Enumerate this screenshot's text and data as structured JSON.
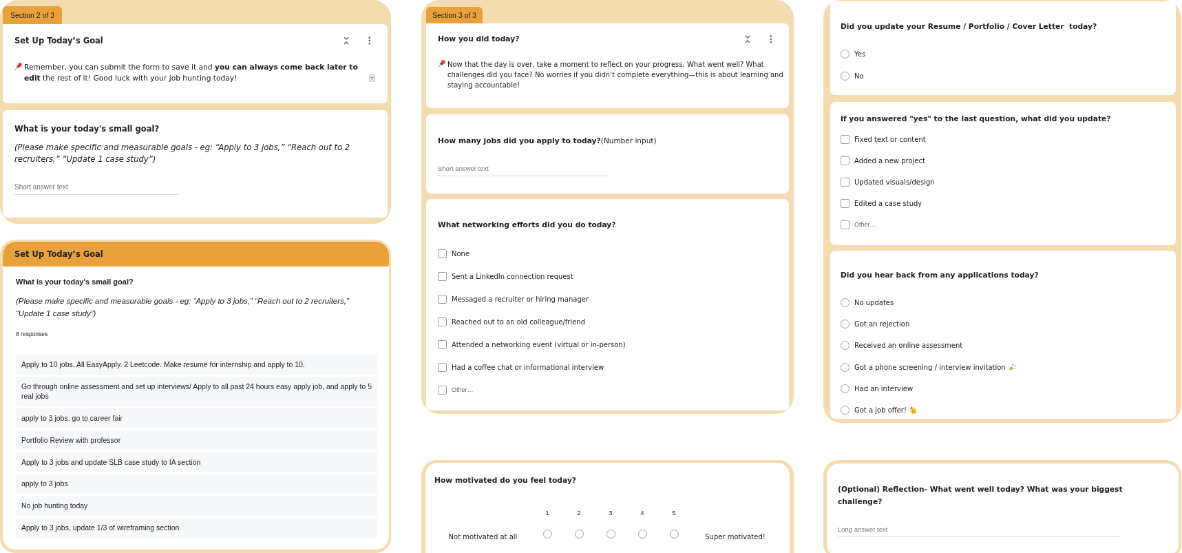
{
  "section_2": {
    "section_label": "Section 2 of 3",
    "header": {
      "title": "Set Up Today’s Goal",
      "description": "Remember, you can submit the form to save it and **you can always come back later to edit** the rest of it! Good luck with your job hunting today!",
      "closing_icon": true
    },
    "questions": [
      {
        "kind": "short_answer",
        "title": "What is your today's small goal?",
        "description": "(Please make specific and measurable goals - eg: “Apply to 3 jobs,” “Reach out to 2 recruiters,” “Update 1 case study”)",
        "placeholder": "Short answer text"
      }
    ]
  },
  "responses_summary": {
    "header": "Set Up Today’s Goal",
    "question": "What is your today's small goal?",
    "description": "(Please make specific and measurable goals - eg: “Apply to 3 jobs,” “Reach out to 2 recruiters,” “Update 1 case study”)",
    "response_count": "8 responses",
    "responses": [
      "Apply to 10 jobs. All EasyApply. 2 Leetcode. Make resume for internship and apply to 10.",
      "Go through online assessment and set up interviews/ Apply to all past 24 hours easy apply job, and apply to 5 real jobs",
      "apply to 3 jobs, go to career fair",
      "Portfolio Review with professor",
      "Apply to 3 jobs and update SLB case study to IA section",
      "apply to 3 jobs",
      "No job hunting today",
      "Apply to 3 jobs, update 1/3 of wireframing section"
    ]
  },
  "section_3": {
    "section_label": "Section 3 of 3",
    "header": {
      "title": "How you did today?",
      "description": "Now that the day is over, take a moment to reflect on your progress. What went well? What challenges did you face? No worries if you didn’t complete everything—this is about learning and staying accountable!"
    },
    "questions": [
      {
        "kind": "short_answer",
        "title": "How many jobs did you apply to today?",
        "title_note": "(Number input)",
        "placeholder": "Short answer text"
      },
      {
        "kind": "checkboxes",
        "title": "What networking efforts did you do today?",
        "options": [
          {
            "kind": "option",
            "label": "None",
            "checked": false
          },
          {
            "kind": "option",
            "label": "Sent a LinkedIn connection request",
            "checked": false
          },
          {
            "kind": "option",
            "label": "Messaged a recruiter or hiring manager",
            "checked": false
          },
          {
            "kind": "option",
            "label": "Reached out to an old colleague/friend",
            "checked": false
          },
          {
            "kind": "option",
            "label": "Attended a networking event (virtual or in-person)",
            "checked": false
          },
          {
            "kind": "option",
            "label": "Had a coffee chat or informational interview",
            "checked": false
          },
          {
            "kind": "other",
            "label": "Other…",
            "checked": false
          }
        ]
      }
    ]
  },
  "motivation_question": {
    "kind": "linear_scale",
    "title": "How motivated do you feel today?",
    "low_label": "Not motivated at all",
    "points": [
      {
        "label": "1",
        "selected": false
      },
      {
        "label": "2",
        "selected": false
      },
      {
        "label": "3",
        "selected": false
      },
      {
        "label": "4",
        "selected": false
      },
      {
        "label": "5",
        "selected": false
      }
    ],
    "high_label": "Super motivated!"
  },
  "section_3_continued": {
    "questions": [
      {
        "kind": "multiple_choice",
        "title": "Did you update your Resume / Portfolio / Cover Letter  today?",
        "options": [
          {
            "label": "Yes",
            "selected": false
          },
          {
            "label": "No",
            "selected": false
          }
        ]
      },
      {
        "kind": "checkboxes",
        "title": "If you answered \"yes\" to the last question, what did you update?",
        "options": [
          {
            "kind": "option",
            "label": "Fixed text or content",
            "checked": false
          },
          {
            "kind": "option",
            "label": "Added a new project",
            "checked": false
          },
          {
            "kind": "option",
            "label": "Updated visuals/design",
            "checked": false
          },
          {
            "kind": "option",
            "label": "Edited a case study",
            "checked": false
          },
          {
            "kind": "other",
            "label": "Other…",
            "checked": false
          }
        ]
      },
      {
        "kind": "multiple_choice",
        "title": "Did you hear back from any applications today?",
        "options": [
          {
            "kind": "plain",
            "label": "No updates",
            "selected": false
          },
          {
            "kind": "plain",
            "label": "Got an rejection",
            "selected": false
          },
          {
            "kind": "plain",
            "label": "Received an online assessment",
            "selected": false
          },
          {
            "kind": "confetti",
            "label": "Got a phone screening / interview invitation",
            "selected": false
          },
          {
            "kind": "plain",
            "label": "Had an interview",
            "selected": false
          },
          {
            "kind": "party",
            "label": "Got a job offer!",
            "selected": false
          }
        ]
      }
    ]
  },
  "reflection_question": {
    "kind": "paragraph",
    "title": "(Optional) Reflection- What went well today? What was your biggest challenge?",
    "placeholder": "Long answer text"
  }
}
